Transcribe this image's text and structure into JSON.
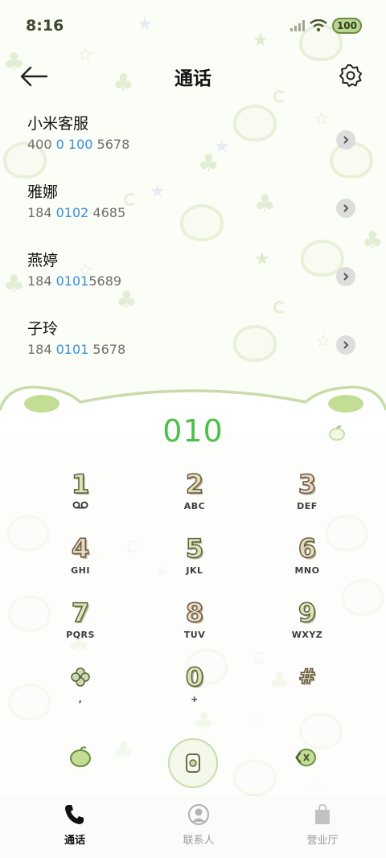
{
  "status": {
    "time": "8:16",
    "battery": "100"
  },
  "header": {
    "title": "通话"
  },
  "calls": [
    {
      "name": "小米客服",
      "num_pre": "400 ",
      "num_hl": "0 100",
      "num_post": " 5678"
    },
    {
      "name": "雅娜",
      "num_pre": "184 ",
      "num_hl": "0102",
      "num_post": " 4685"
    },
    {
      "name": "燕婷",
      "num_pre": "184 ",
      "num_hl": "0101",
      "num_post": "5689"
    },
    {
      "name": "子玲",
      "num_pre": "184 ",
      "num_hl": "0101",
      "num_post": " 5678"
    }
  ],
  "dial": {
    "display": "010"
  },
  "keys": [
    {
      "digit": "1",
      "letters": "",
      "digit_color": "#d8e6b8"
    },
    {
      "digit": "2",
      "letters": "ABC",
      "digit_color": "#ead8bb"
    },
    {
      "digit": "3",
      "letters": "DEF",
      "digit_color": "#f0d2c6"
    },
    {
      "digit": "4",
      "letters": "GHI",
      "digit_color": "#f0d2c6"
    },
    {
      "digit": "5",
      "letters": "JKL",
      "digit_color": "#d8e6b8"
    },
    {
      "digit": "6",
      "letters": "MNO",
      "digit_color": "#ead8bb"
    },
    {
      "digit": "7",
      "letters": "PQRS",
      "digit_color": "#d8e6b8"
    },
    {
      "digit": "8",
      "letters": "TUV",
      "digit_color": "#f0d2c6"
    },
    {
      "digit": "9",
      "letters": "WXYZ",
      "digit_color": "#d8e6b8"
    },
    {
      "digit": "",
      "letters": ",",
      "digit_color": "#c7dcaa"
    },
    {
      "digit": "0",
      "letters": "+",
      "digit_color": "#d8e6b8"
    },
    {
      "digit": "#",
      "letters": "",
      "digit_color": "#f0d2c6"
    }
  ],
  "nav": [
    {
      "label": "通话",
      "icon": "phone-icon",
      "active": true
    },
    {
      "label": "联系人",
      "icon": "person-icon",
      "active": false
    },
    {
      "label": "营业厅",
      "icon": "shopping-bag-icon",
      "active": false
    }
  ],
  "colors": {
    "accent_green": "#4fbf4b",
    "number_highlight": "#3a8fd9",
    "panel_green": "#c7dcaa"
  }
}
